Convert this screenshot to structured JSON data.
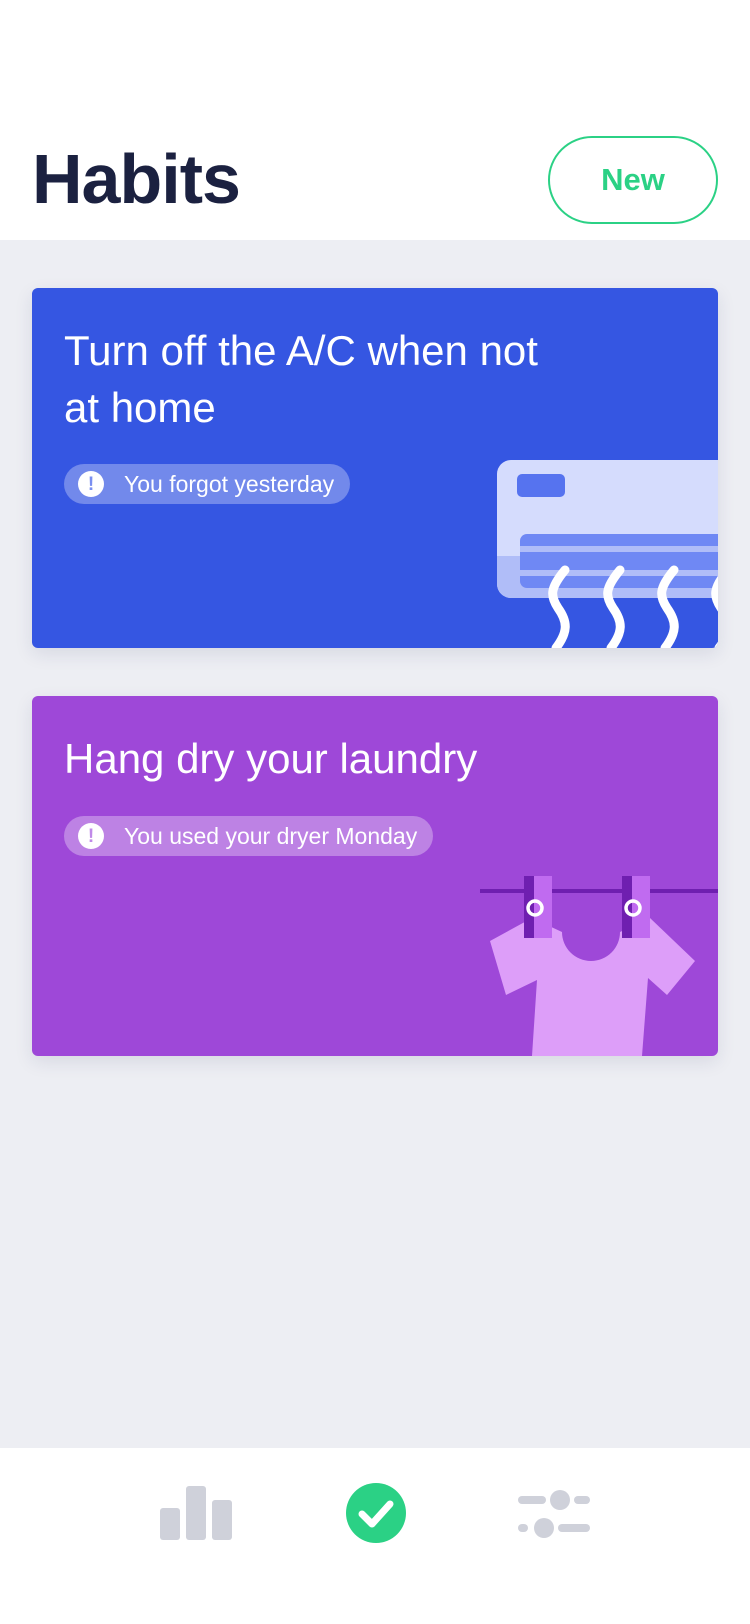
{
  "header": {
    "title": "Habits",
    "new_button_label": "New"
  },
  "habits": [
    {
      "title": "Turn off the A/C when not at home",
      "status": "You forgot yesterday",
      "color": "#3556e2",
      "illustration": "air-conditioner"
    },
    {
      "title": "Hang dry your laundry",
      "status": "You used your dryer Monday",
      "color": "#9e48d8",
      "illustration": "shirt-on-clothesline"
    }
  ],
  "nav": {
    "items": [
      {
        "icon": "bar-chart-icon",
        "active": false
      },
      {
        "icon": "check-circle-icon",
        "active": true
      },
      {
        "icon": "sliders-icon",
        "active": false
      }
    ],
    "active_color": "#2bd185",
    "inactive_color": "#cfd1da"
  },
  "colors": {
    "accent": "#2bd185",
    "title_text": "#1b2140",
    "background": "#edeef3"
  }
}
